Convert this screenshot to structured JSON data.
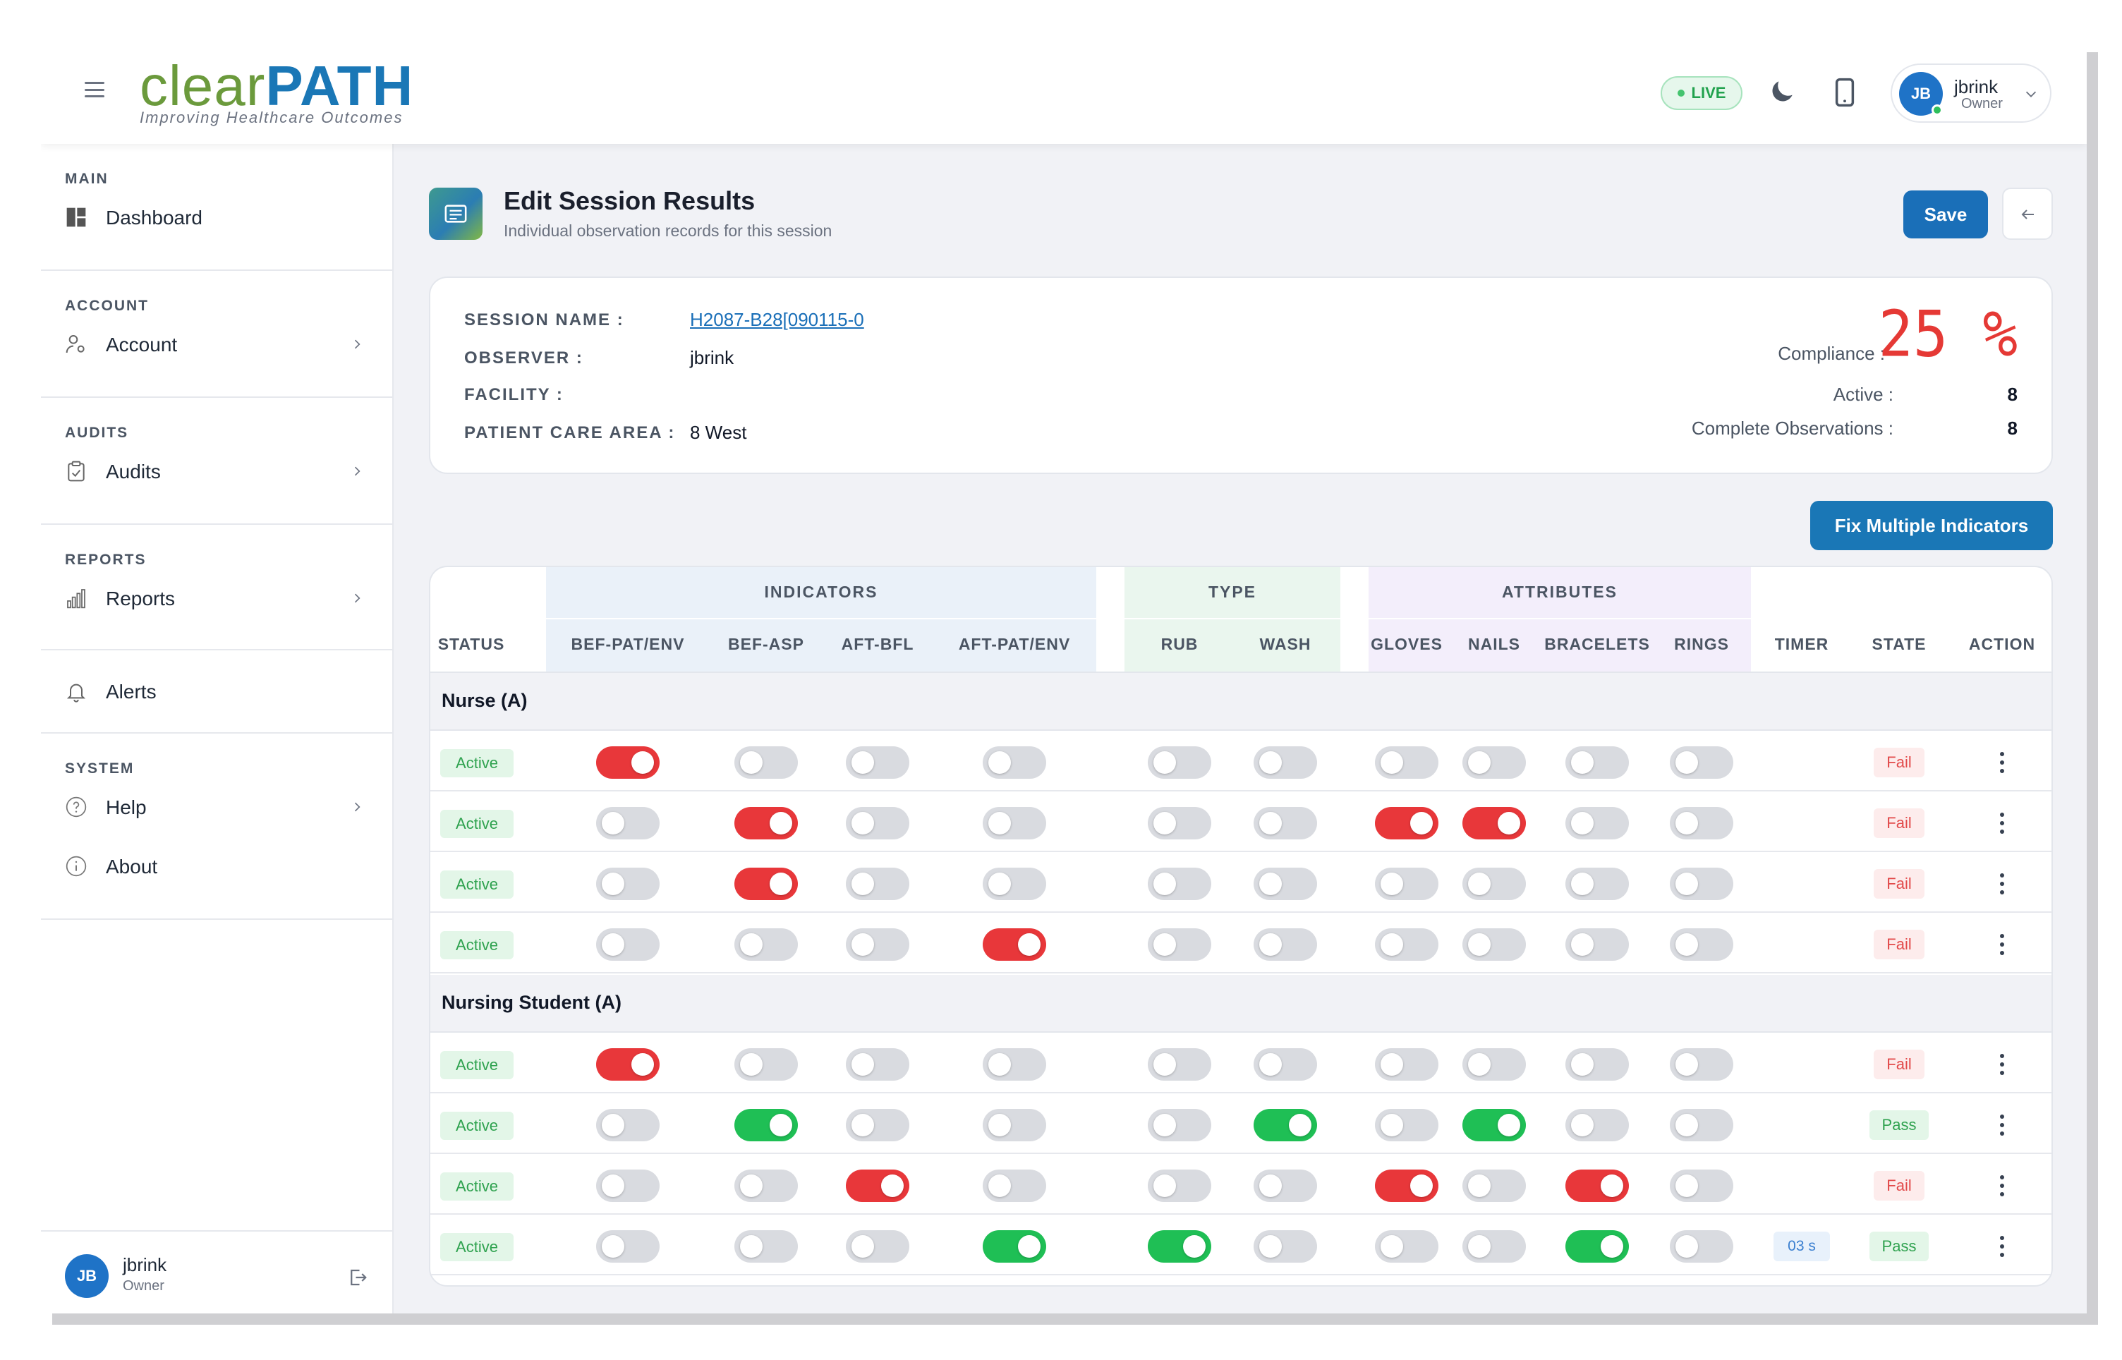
{
  "header": {
    "logo_main_a": "clear",
    "logo_main_b": "PATH",
    "logo_tagline": "Improving Healthcare Outcomes",
    "live_label": "LIVE",
    "user": {
      "initials": "JB",
      "name": "jbrink",
      "role": "Owner"
    },
    "icons": [
      "hamburger-icon",
      "moon-icon",
      "phone-icon",
      "chevron-down-icon"
    ]
  },
  "sidebar": {
    "sections": [
      {
        "title": "MAIN",
        "items": [
          {
            "label": "Dashboard",
            "icon": "dashboard-icon"
          }
        ]
      },
      {
        "title": "ACCOUNT",
        "items": [
          {
            "label": "Account",
            "icon": "user-gear-icon"
          }
        ]
      },
      {
        "title": "AUDITS",
        "items": [
          {
            "label": "Audits",
            "icon": "clipboard-icon"
          }
        ]
      },
      {
        "title": "REPORTS",
        "items": [
          {
            "label": "Reports",
            "icon": "bar-chart-icon"
          }
        ]
      },
      {
        "title": "",
        "items": [
          {
            "label": "Alerts",
            "icon": "bell-icon"
          }
        ]
      },
      {
        "title": "SYSTEM",
        "items": [
          {
            "label": "Help",
            "icon": "help-icon"
          },
          {
            "label": "About",
            "icon": "info-icon"
          }
        ]
      }
    ],
    "user": {
      "initials": "JB",
      "name": "jbrink",
      "role": "Owner"
    }
  },
  "page": {
    "title": "Edit Session Results",
    "subtitle": "Individual observation records for this session",
    "save_label": "Save",
    "fix_label": "Fix Multiple Indicators"
  },
  "session": {
    "name_label": "SESSION NAME :",
    "name_value": "H2087-B28[090115-0",
    "observer_label": "OBSERVER :",
    "observer_value": "jbrink",
    "facility_label": "FACILITY :",
    "facility_value": "",
    "area_label": "PATIENT CARE AREA :",
    "area_value": "8 West",
    "compliance_label": "Compliance :",
    "compliance_value": "25 %",
    "active_label": "Active :",
    "active_value": "8",
    "complete_label": "Complete Observations :",
    "complete_value": "8"
  },
  "table": {
    "groups": {
      "indicators": "INDICATORS",
      "type": "TYPE",
      "attributes": "ATTRIBUTES"
    },
    "columns": {
      "status": "STATUS",
      "bef_pat_env": "BEF-PAT/ENV",
      "bef_asp": "BEF-ASP",
      "aft_bfl": "AFT-BFL",
      "aft_pat_env": "AFT-PAT/ENV",
      "rub": "RUB",
      "wash": "WASH",
      "gloves": "GLOVES",
      "nails": "NAILS",
      "bracelets": "BRACELETS",
      "rings": "RINGS",
      "timer": "TIMER",
      "state": "STATE",
      "action": "ACTION"
    },
    "row_groups": [
      {
        "label": "Nurse (A)",
        "rows": [
          {
            "status": "Active",
            "toggles": [
              "red",
              "off",
              "off",
              "off",
              "off",
              "off",
              "off",
              "off",
              "off",
              "off"
            ],
            "timer": "",
            "state": "Fail"
          },
          {
            "status": "Active",
            "toggles": [
              "off",
              "red",
              "off",
              "off",
              "off",
              "off",
              "red",
              "red",
              "off",
              "off"
            ],
            "timer": "",
            "state": "Fail"
          },
          {
            "status": "Active",
            "toggles": [
              "off",
              "red",
              "off",
              "off",
              "off",
              "off",
              "off",
              "off",
              "off",
              "off"
            ],
            "timer": "",
            "state": "Fail"
          },
          {
            "status": "Active",
            "toggles": [
              "off",
              "off",
              "off",
              "red",
              "off",
              "off",
              "off",
              "off",
              "off",
              "off"
            ],
            "timer": "",
            "state": "Fail"
          }
        ]
      },
      {
        "label": "Nursing Student (A)",
        "rows": [
          {
            "status": "Active",
            "toggles": [
              "red",
              "off",
              "off",
              "off",
              "off",
              "off",
              "off",
              "off",
              "off",
              "off"
            ],
            "timer": "",
            "state": "Fail"
          },
          {
            "status": "Active",
            "toggles": [
              "off",
              "green",
              "off",
              "off",
              "off",
              "green",
              "off",
              "green",
              "off",
              "off"
            ],
            "timer": "",
            "state": "Pass"
          },
          {
            "status": "Active",
            "toggles": [
              "off",
              "off",
              "red",
              "off",
              "off",
              "off",
              "red",
              "off",
              "red",
              "off"
            ],
            "timer": "",
            "state": "Fail"
          },
          {
            "status": "Active",
            "toggles": [
              "off",
              "off",
              "off",
              "green",
              "green",
              "off",
              "off",
              "off",
              "green",
              "off"
            ],
            "timer": "03 s",
            "state": "Pass"
          }
        ]
      }
    ]
  }
}
